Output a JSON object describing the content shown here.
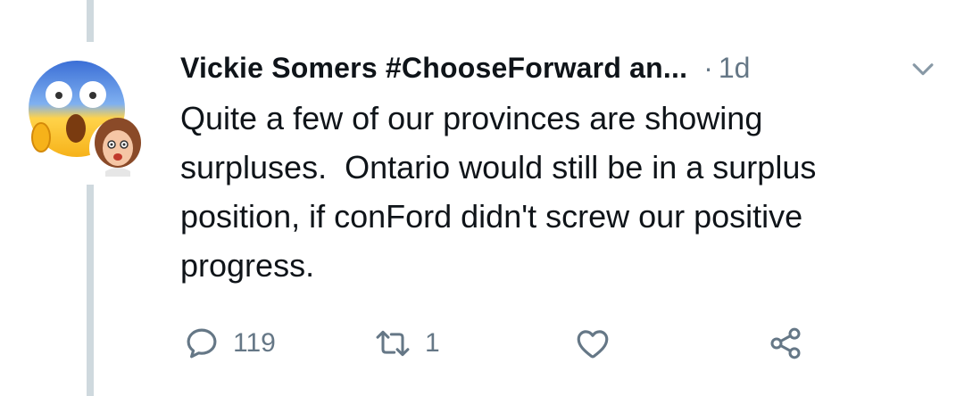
{
  "tweet": {
    "author_name": "Vickie Somers #ChooseForward an...",
    "separator": "·",
    "timestamp": "1d",
    "text": "Quite a few of our provinces are showing\nsurpluses.  Ontario would still be in a surplus\nposition, if conFord didn't screw our positive\nprogress."
  },
  "actions": {
    "reply_count": "119",
    "retweet_count": "1"
  },
  "icons": {
    "avatar": "shocked-emoji-avatar",
    "avatar_badge": "bitmoji-avatar",
    "menu": "chevron-down-icon",
    "reply": "reply-icon",
    "retweet": "retweet-icon",
    "like": "heart-icon",
    "share": "share-icon"
  },
  "colors": {
    "text_primary": "#0f1419",
    "text_secondary": "#657786",
    "thread_line": "#cfd9de"
  }
}
